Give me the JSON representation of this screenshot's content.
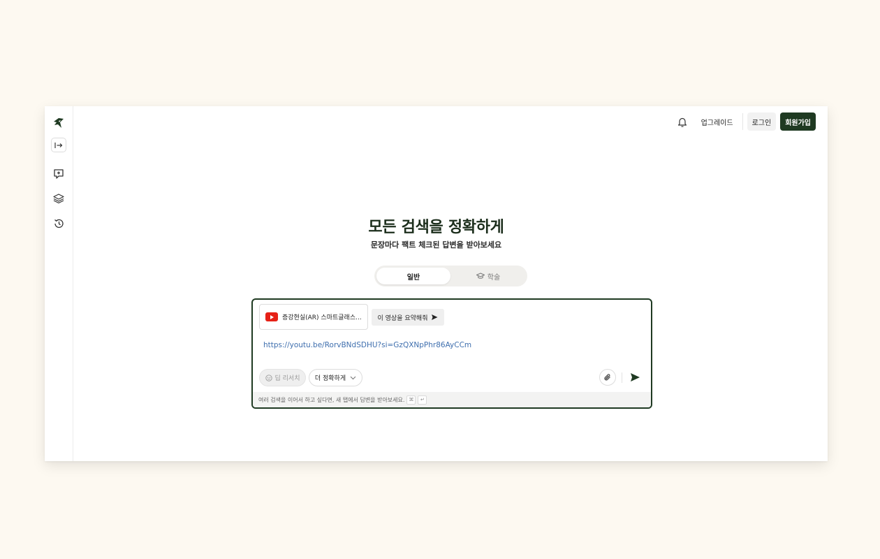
{
  "sidebar": {
    "logo": "app-logo",
    "icons": [
      "expand-sidebar-icon",
      "new-chat-icon",
      "layers-icon",
      "history-icon"
    ]
  },
  "header": {
    "upgrade_label": "업그레이드",
    "login_label": "로그인",
    "signup_label": "회원가입"
  },
  "hero": {
    "title": "모든 검색을 정확하게",
    "subtitle": "문장마다 팩트 체크된 답변을 받아보세요"
  },
  "mode_toggle": {
    "tabs": [
      {
        "label": "일반",
        "active": true
      },
      {
        "label": "학술",
        "active": false,
        "icon": "graduation-cap-icon"
      }
    ]
  },
  "composer": {
    "attachment": {
      "icon": "youtube-icon",
      "title": "증강현실(AR) 스마트글래스..."
    },
    "summarize_label": "이 영상을 요약해줘",
    "input_value": "https://youtu.be/RorvBNdSDHU?si=GzQXNpPhr86AyCCm",
    "deep_research_label": "딥 리서치",
    "mode_select_value": "더 정확하게",
    "hint_text": "여러 검색을 이어서 하고 싶다면, 새 탭에서 답변을 받아보세요.",
    "hint_keys": [
      "⌘",
      "↵"
    ]
  },
  "colors": {
    "brand": "#1f3a22",
    "page_bg": "#fdf9f1",
    "link": "#3f6fae",
    "youtube_red": "#e62117"
  }
}
